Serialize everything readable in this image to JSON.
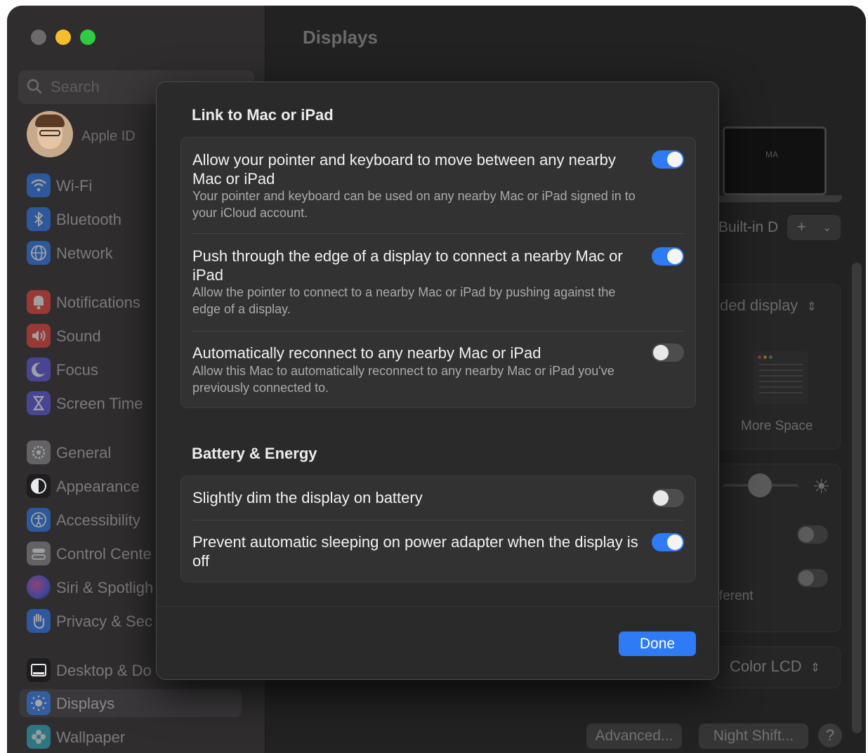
{
  "window": {
    "title": "Displays"
  },
  "sidebar": {
    "search_placeholder": "Search",
    "apple_id_label": "Apple ID",
    "items": [
      {
        "label": "Wi-Fi",
        "icon": "wifi-icon",
        "color": "#2d7cf6"
      },
      {
        "label": "Bluetooth",
        "icon": "bluetooth-icon",
        "color": "#2d7cf6"
      },
      {
        "label": "Network",
        "icon": "globe-icon",
        "color": "#2d7cf6"
      },
      {
        "label": "Notifications",
        "icon": "bell-icon",
        "color": "#f0443b"
      },
      {
        "label": "Sound",
        "icon": "speaker-icon",
        "color": "#f0443b"
      },
      {
        "label": "Focus",
        "icon": "moon-icon",
        "color": "#5d5ce6"
      },
      {
        "label": "Screen Time",
        "icon": "hourglass-icon",
        "color": "#5d5ce6"
      },
      {
        "label": "General",
        "icon": "gear-icon",
        "color": "#8e8e93"
      },
      {
        "label": "Appearance",
        "icon": "appearance-icon",
        "color": "#1c1c1e"
      },
      {
        "label": "Accessibility",
        "icon": "accessibility-icon",
        "color": "#2d7cf6"
      },
      {
        "label": "Control Cente",
        "icon": "control-center-icon",
        "color": "#8e8e93"
      },
      {
        "label": "Siri & Spotligh",
        "icon": "siri-icon",
        "color": "#b34fe0"
      },
      {
        "label": "Privacy & Sec",
        "icon": "hand-icon",
        "color": "#2d7cf6"
      },
      {
        "label": "Desktop & Do",
        "icon": "dock-icon",
        "color": "#1c1c1e"
      },
      {
        "label": "Displays",
        "icon": "sun-icon",
        "color": "#2d7cf6"
      },
      {
        "label": "Wallpaper",
        "icon": "flower-icon",
        "color": "#30b0c7"
      }
    ]
  },
  "background": {
    "builtin_label": "Built-in D",
    "extended_label": "ded display",
    "more_space_label": "More Space",
    "different_label": "fferent",
    "color_profile": "Color LCD",
    "advanced_button": "Advanced...",
    "night_shift_button": "Night Shift...",
    "help_button": "?",
    "laptop_mark": "MA"
  },
  "dialog": {
    "section1_title": "Link to Mac or iPad",
    "link_rows": [
      {
        "title": "Allow your pointer and keyboard to move between any nearby Mac or iPad",
        "subtitle": "Your pointer and keyboard can be used on any nearby Mac or iPad signed in to your iCloud account.",
        "enabled": true
      },
      {
        "title": "Push through the edge of a display to connect a nearby Mac or iPad",
        "subtitle": "Allow the pointer to connect to a nearby Mac or iPad by pushing against the edge of a display.",
        "enabled": true
      },
      {
        "title": "Automatically reconnect to any nearby Mac or iPad",
        "subtitle": "Allow this Mac to automatically reconnect to any nearby Mac or iPad you've previously connected to.",
        "enabled": false
      }
    ],
    "section2_title": "Battery & Energy",
    "battery_rows": [
      {
        "title": "Slightly dim the display on battery",
        "enabled": false
      },
      {
        "title": "Prevent automatic sleeping on power adapter when the display is off",
        "enabled": true
      }
    ],
    "done_label": "Done",
    "accent_color": "#2f7bf5"
  }
}
